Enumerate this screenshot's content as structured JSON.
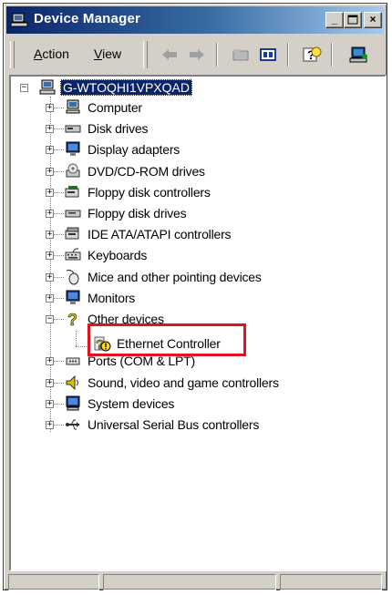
{
  "window": {
    "title": "Device Manager"
  },
  "menu": {
    "action": {
      "accel": "A",
      "rest": "ction"
    },
    "view": {
      "accel": "V",
      "rest": "iew"
    }
  },
  "toolbar": {
    "buttons": [
      "back-icon",
      "forward-icon",
      "up-folder-icon",
      "properties-icon",
      "help-icon",
      "scan-hardware-icon"
    ]
  },
  "tree": {
    "root": "G-WTOQHI1VPXQAD",
    "nodes": [
      {
        "label": "Computer",
        "icon": "computer-icon",
        "expanded": false
      },
      {
        "label": "Disk drives",
        "icon": "disk-drive-icon",
        "expanded": false
      },
      {
        "label": "Display adapters",
        "icon": "display-adapter-icon",
        "expanded": false
      },
      {
        "label": "DVD/CD-ROM drives",
        "icon": "cdrom-icon",
        "expanded": false
      },
      {
        "label": "Floppy disk controllers",
        "icon": "floppy-controller-icon",
        "expanded": false
      },
      {
        "label": "Floppy disk drives",
        "icon": "floppy-drive-icon",
        "expanded": false
      },
      {
        "label": "IDE ATA/ATAPI controllers",
        "icon": "ide-controller-icon",
        "expanded": false
      },
      {
        "label": "Keyboards",
        "icon": "keyboard-icon",
        "expanded": false
      },
      {
        "label": "Mice and other pointing devices",
        "icon": "mouse-icon",
        "expanded": false
      },
      {
        "label": "Monitors",
        "icon": "monitor-icon",
        "expanded": false
      },
      {
        "label": "Other devices",
        "icon": "unknown-device-icon",
        "expanded": true
      },
      {
        "label": "Ports (COM & LPT)",
        "icon": "port-icon",
        "expanded": false
      },
      {
        "label": "Sound, video and game controllers",
        "icon": "sound-icon",
        "expanded": false
      },
      {
        "label": "System devices",
        "icon": "system-device-icon",
        "expanded": false
      },
      {
        "label": "Universal Serial Bus controllers",
        "icon": "usb-icon",
        "expanded": false
      }
    ],
    "child": {
      "label": "Ethernet Controller",
      "icon": "warning-device-icon",
      "parent": "Other devices"
    }
  },
  "colors": {
    "title_gradient_start": "#0a246a",
    "title_gradient_end": "#a6caf0",
    "selection": "#0a246a",
    "highlight_box": "#e0141e",
    "chrome": "#d4d0c8"
  }
}
